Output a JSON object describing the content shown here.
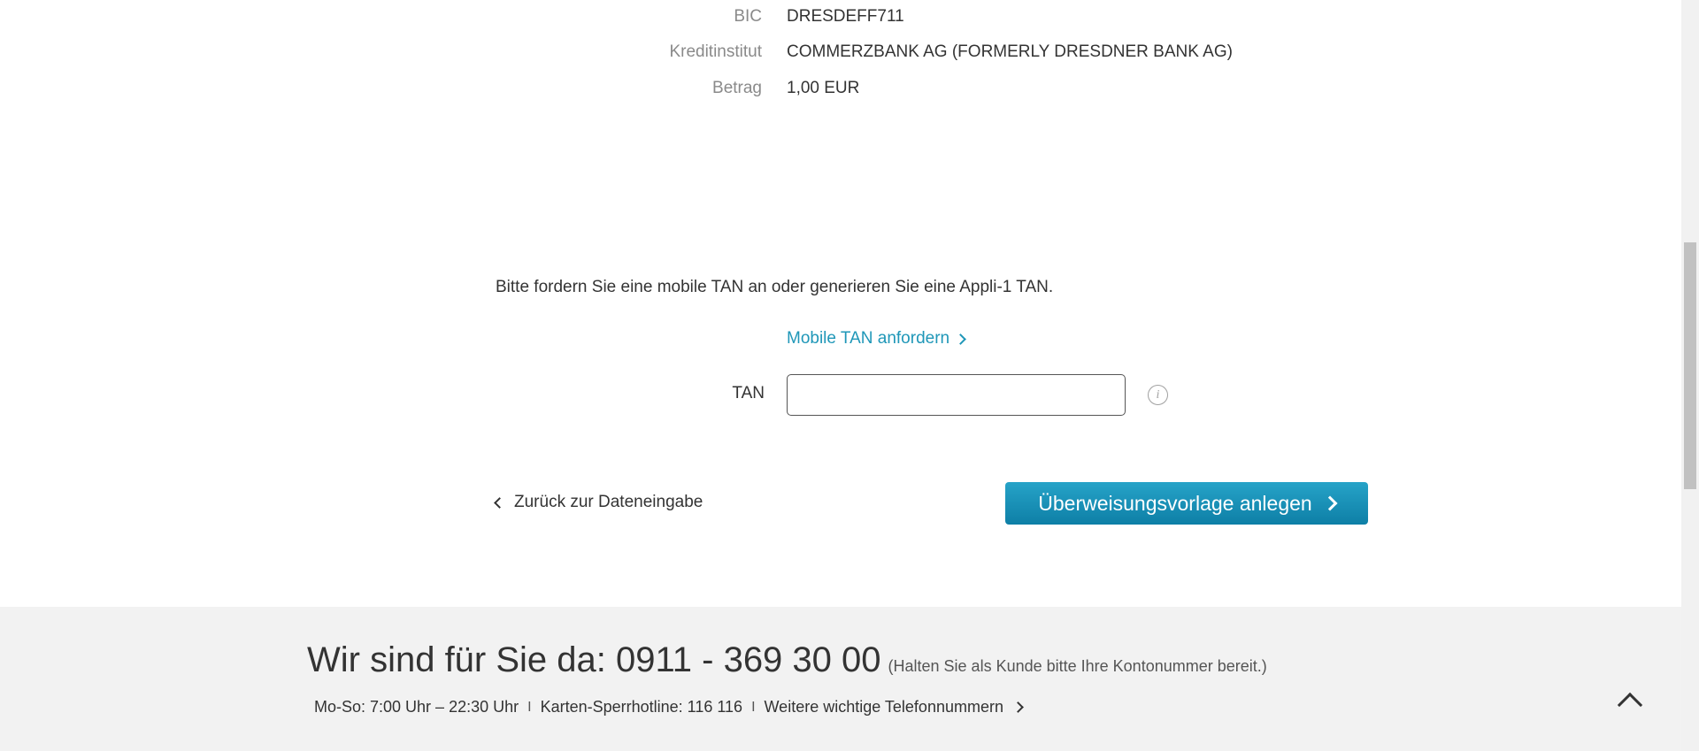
{
  "summary": {
    "rows": [
      {
        "label": "BIC",
        "value": "DRESDEFF711"
      },
      {
        "label": "Kreditinstitut",
        "value": "COMMERZBANK AG (FORMERLY DRESDNER BANK AG)"
      },
      {
        "label": "Betrag",
        "value": "1,00 EUR"
      }
    ]
  },
  "tan_section": {
    "instruction": "Bitte fordern Sie eine mobile TAN an oder generieren Sie eine Appli-1 TAN.",
    "request_link": "Mobile TAN anfordern",
    "tan_label": "TAN",
    "tan_value": "",
    "tan_placeholder": "",
    "info_icon": "info-icon"
  },
  "actions": {
    "back_label": "Zurück zur Dateneingabe",
    "submit_label": "Überweisungsvorlage anlegen"
  },
  "footer": {
    "heading": "Wir sind für Sie da: 0911 - 369 30 00",
    "heading_note": "(Halten Sie als Kunde bitte Ihre Kontonummer bereit.)",
    "hours": "Mo-So: 7:00 Uhr – 22:30 Uhr",
    "hotline": "Karten-Sperrhotline: 116 116",
    "more_numbers": "Weitere wichtige Telefonnummern",
    "separator": "I"
  },
  "colors": {
    "accent": "#1f97b8",
    "button_top": "#26a3c8",
    "button_bottom": "#0e7fa6",
    "footer_bg": "#f2f2f2"
  }
}
